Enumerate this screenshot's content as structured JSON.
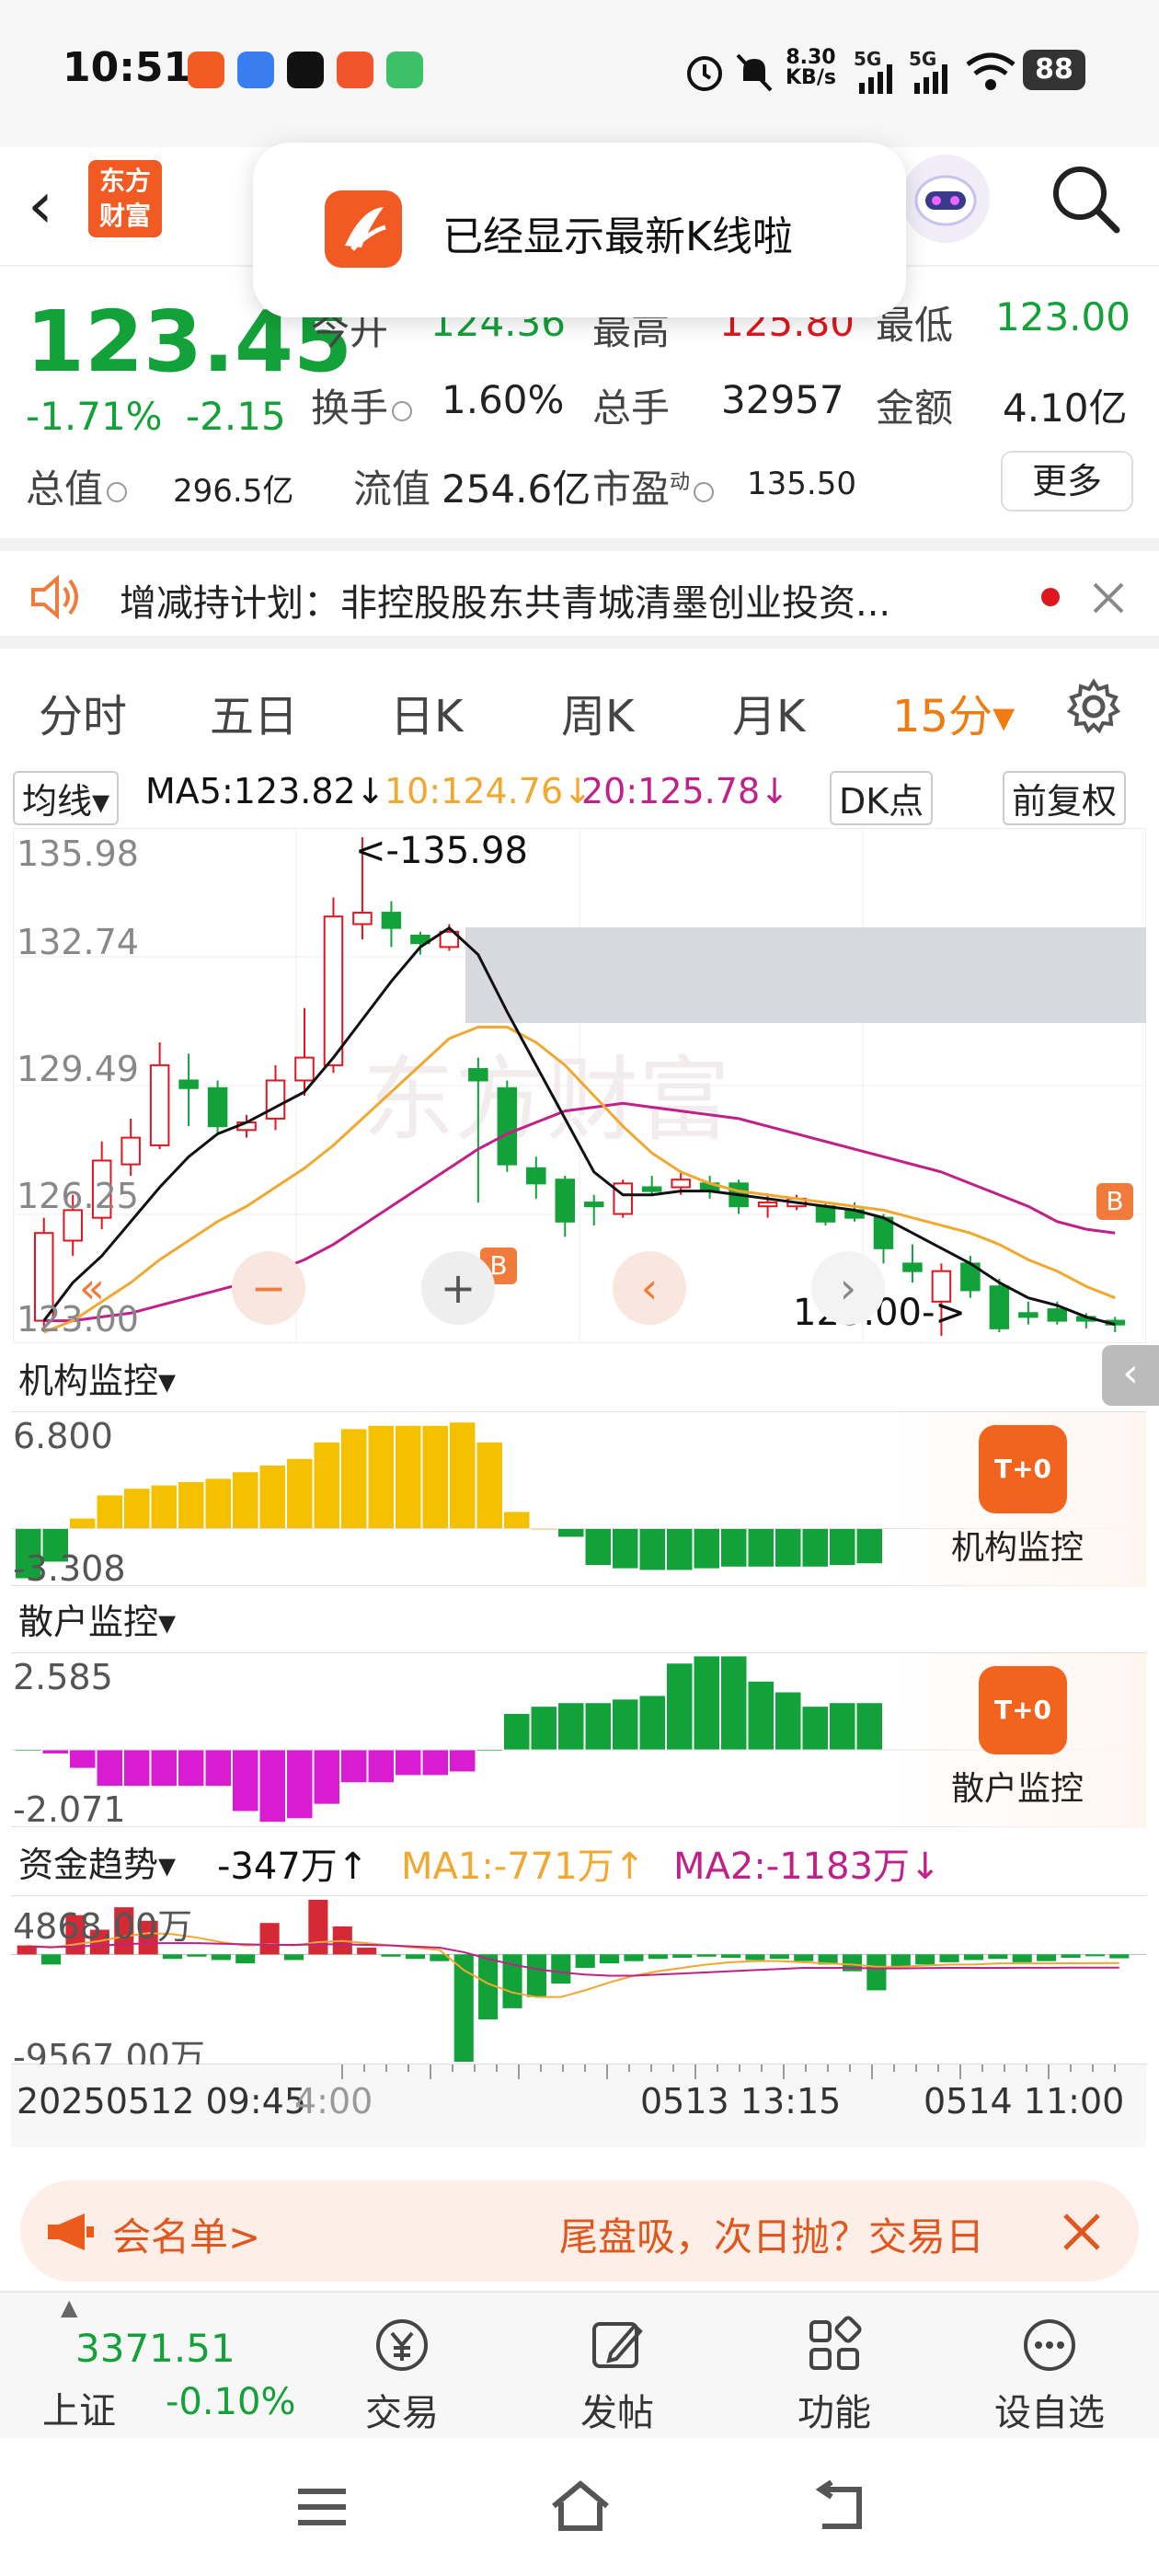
{
  "status": {
    "time": "10:51",
    "net_speed_value": "8.30",
    "net_speed_unit": "KB/s",
    "battery": "88",
    "sig1": "5G",
    "sig2": "5G"
  },
  "header": {
    "back": "‹",
    "logo_line1": "东方",
    "logo_line2": "财富"
  },
  "toast": {
    "text": "已经显示最新K线啦"
  },
  "quote": {
    "price": "123.45",
    "change_pct": "-1.71%",
    "change_amt": "-2.15",
    "open_label": "今开",
    "open_val": "124.36",
    "high_label": "最高",
    "high_val": "125.80",
    "low_label": "最低",
    "low_val": "123.00",
    "turnover_label": "换手",
    "turnover_val": "1.60%",
    "volume_label": "总手",
    "volume_val": "32957",
    "amount_label": "金额",
    "amount_val": "4.10亿",
    "mktcap_label": "总值",
    "mktcap_val": "296.5亿",
    "float_label": "流值",
    "float_val": "254.6亿",
    "pe_label": "市盈",
    "pe_sup": "动",
    "pe_val": "135.50",
    "more_button": "更多"
  },
  "notice": {
    "text": "增减持计划：非控股股东共青城清墨创业投资..."
  },
  "tabs": [
    {
      "label": "分时"
    },
    {
      "label": "五日"
    },
    {
      "label": "日K"
    },
    {
      "label": "周K"
    },
    {
      "label": "月K"
    },
    {
      "label": "15分▾"
    }
  ],
  "ma_row": {
    "avg_button": "均线▾",
    "ma5": "MA5:123.82↓",
    "ma10": "10:124.76↓",
    "ma20": "20:125.78↓",
    "dk_button": "DK点",
    "adj_button": "前复权"
  },
  "colors": {
    "up": "#e0161f",
    "down": "#13a13a",
    "ma5": "#111111",
    "ma10": "#f0a830",
    "ma20": "#c0208a",
    "accent": "#f07b10"
  },
  "chart_data": {
    "type": "candlestick",
    "title": "",
    "y_ticks": [
      "135.98",
      "132.74",
      "129.49",
      "126.25",
      "123.00"
    ],
    "ylim": [
      123.0,
      135.98
    ],
    "max_label": "<-135.98",
    "min_label": "123.00->",
    "candles": [
      {
        "o": 123.3,
        "c": 125.6,
        "h": 126.0,
        "l": 123.0
      },
      {
        "o": 125.4,
        "c": 126.2,
        "h": 126.6,
        "l": 125.0
      },
      {
        "o": 126.0,
        "c": 127.5,
        "h": 128.0,
        "l": 125.7
      },
      {
        "o": 127.4,
        "c": 128.1,
        "h": 128.6,
        "l": 127.1
      },
      {
        "o": 127.9,
        "c": 130.0,
        "h": 130.6,
        "l": 127.8
      },
      {
        "o": 129.6,
        "c": 129.4,
        "h": 130.3,
        "l": 128.4
      },
      {
        "o": 129.4,
        "c": 128.4,
        "h": 129.6,
        "l": 128.2
      },
      {
        "o": 128.3,
        "c": 128.5,
        "h": 128.7,
        "l": 128.1
      },
      {
        "o": 128.6,
        "c": 129.6,
        "h": 130.0,
        "l": 128.3
      },
      {
        "o": 129.6,
        "c": 130.2,
        "h": 131.5,
        "l": 129.2
      },
      {
        "o": 130.0,
        "c": 133.9,
        "h": 134.4,
        "l": 129.8
      },
      {
        "o": 133.7,
        "c": 134.0,
        "h": 135.98,
        "l": 133.3
      },
      {
        "o": 134.0,
        "c": 133.6,
        "h": 134.3,
        "l": 133.1
      },
      {
        "o": 133.4,
        "c": 133.2,
        "h": 133.5,
        "l": 132.9
      },
      {
        "o": 133.1,
        "c": 133.5,
        "h": 133.7,
        "l": 133.0
      },
      {
        "o": 129.9,
        "c": 129.6,
        "h": 130.2,
        "l": 126.4
      },
      {
        "o": 129.4,
        "c": 127.4,
        "h": 129.6,
        "l": 127.2
      },
      {
        "o": 127.3,
        "c": 126.9,
        "h": 127.6,
        "l": 126.5
      },
      {
        "o": 127.0,
        "c": 125.9,
        "h": 127.1,
        "l": 125.5
      },
      {
        "o": 126.4,
        "c": 126.3,
        "h": 126.6,
        "l": 125.8
      },
      {
        "o": 126.1,
        "c": 126.9,
        "h": 127.0,
        "l": 126.0
      },
      {
        "o": 126.8,
        "c": 126.7,
        "h": 127.1,
        "l": 126.6
      },
      {
        "o": 126.8,
        "c": 127.0,
        "h": 127.2,
        "l": 126.6
      },
      {
        "o": 126.9,
        "c": 126.7,
        "h": 127.1,
        "l": 126.5
      },
      {
        "o": 126.9,
        "c": 126.3,
        "h": 127.0,
        "l": 126.1
      },
      {
        "o": 126.3,
        "c": 126.4,
        "h": 126.6,
        "l": 126.0
      },
      {
        "o": 126.3,
        "c": 126.5,
        "h": 126.6,
        "l": 126.2
      },
      {
        "o": 126.3,
        "c": 125.9,
        "h": 126.4,
        "l": 125.8
      },
      {
        "o": 126.2,
        "c": 126.0,
        "h": 126.4,
        "l": 125.9
      },
      {
        "o": 126.0,
        "c": 125.2,
        "h": 126.1,
        "l": 124.8
      },
      {
        "o": 124.8,
        "c": 124.6,
        "h": 125.3,
        "l": 124.3
      },
      {
        "o": 123.8,
        "c": 124.6,
        "h": 124.8,
        "l": 122.9
      },
      {
        "o": 124.8,
        "c": 124.1,
        "h": 125.0,
        "l": 123.9
      },
      {
        "o": 124.2,
        "c": 123.1,
        "h": 124.4,
        "l": 123.0
      },
      {
        "o": 123.5,
        "c": 123.4,
        "h": 123.8,
        "l": 123.2
      },
      {
        "o": 123.6,
        "c": 123.3,
        "h": 123.8,
        "l": 123.2
      },
      {
        "o": 123.4,
        "c": 123.3,
        "h": 123.5,
        "l": 123.1
      },
      {
        "o": 123.3,
        "c": 123.2,
        "h": 123.4,
        "l": 123.0
      }
    ],
    "ma5": [
      123.3,
      124.3,
      125.0,
      125.9,
      126.8,
      127.6,
      128.2,
      128.5,
      128.9,
      129.3,
      130.2,
      131.2,
      132.2,
      133.1,
      133.6,
      132.9,
      131.4,
      130.0,
      128.6,
      127.2,
      126.6,
      126.6,
      126.7,
      126.7,
      126.6,
      126.5,
      126.4,
      126.3,
      126.2,
      126.0,
      125.6,
      125.2,
      124.8,
      124.3,
      123.9,
      123.7,
      123.4,
      123.2
    ],
    "ma10": [
      123.0,
      123.3,
      123.8,
      124.3,
      124.9,
      125.4,
      125.9,
      126.3,
      126.8,
      127.3,
      127.9,
      128.6,
      129.3,
      130.0,
      130.7,
      131.0,
      131.0,
      130.6,
      130.0,
      129.2,
      128.4,
      127.7,
      127.2,
      126.9,
      126.7,
      126.6,
      126.5,
      126.4,
      126.3,
      126.2,
      126.0,
      125.8,
      125.6,
      125.3,
      124.9,
      124.6,
      124.2,
      123.9
    ],
    "ma20": [
      123.3,
      123.3,
      123.4,
      123.5,
      123.7,
      123.9,
      124.1,
      124.3,
      124.6,
      124.9,
      125.3,
      125.8,
      126.3,
      126.8,
      127.3,
      127.8,
      128.2,
      128.5,
      128.8,
      128.9,
      129.0,
      128.9,
      128.8,
      128.7,
      128.6,
      128.4,
      128.2,
      128.0,
      127.8,
      127.6,
      127.4,
      127.2,
      126.9,
      126.6,
      126.3,
      125.9,
      125.7,
      125.6
    ],
    "sub_charts": [
      {
        "name": "机构监控",
        "ymax_label": "6.800",
        "ymin_label": "-3.308",
        "ylim": [
          -3.308,
          6.8
        ],
        "values": [
          -3.0,
          -2.0,
          0.6,
          2.0,
          2.4,
          2.6,
          2.8,
          3.0,
          3.4,
          3.8,
          4.2,
          5.2,
          6.0,
          6.2,
          6.2,
          6.2,
          6.4,
          5.2,
          1.0,
          0.0,
          -0.5,
          -2.2,
          -2.4,
          -2.5,
          -2.5,
          -2.4,
          -2.3,
          -2.3,
          -2.3,
          -2.3,
          -2.2,
          -2.1
        ]
      },
      {
        "name": "散户监控",
        "ymax_label": "2.585",
        "ymin_label": "-2.071",
        "ylim": [
          -2.071,
          2.585
        ],
        "values": [
          0.0,
          -0.1,
          -0.5,
          -1.0,
          -1.0,
          -1.0,
          -1.0,
          -1.0,
          -1.7,
          -2.0,
          -1.9,
          -1.5,
          -0.9,
          -0.9,
          -0.7,
          -0.7,
          -0.6,
          0.0,
          1.0,
          1.2,
          1.3,
          1.3,
          1.4,
          1.5,
          2.4,
          2.6,
          2.6,
          1.9,
          1.6,
          1.2,
          1.3,
          1.3
        ]
      },
      {
        "name": "资金趋势",
        "ymax_label": "4868.00万",
        "ymin_label": "-9567.00万",
        "ylim": [
          -9567.0,
          4868.0
        ],
        "value_label": "-347万↑",
        "ma1_label": "MA1:-771万↑",
        "ma2_label": "MA2:-1183万↓",
        "values": [
          800,
          -900,
          3500,
          2200,
          4200,
          3000,
          -400,
          -200,
          -500,
          -800,
          2800,
          -500,
          4868,
          2500,
          600,
          -200,
          -400,
          -600,
          -9567,
          -5800,
          -4800,
          -3800,
          -2600,
          -1200,
          -800,
          -600,
          -400,
          -300,
          -200,
          -300,
          -500,
          -400,
          -600,
          -900,
          -1500,
          -3200,
          -1100,
          -900,
          -700,
          -500,
          -400,
          -700,
          -600,
          -300,
          -100,
          -347
        ],
        "ma1": [
          800,
          600,
          900,
          1200,
          1600,
          1900,
          1800,
          1500,
          1100,
          800,
          900,
          800,
          1100,
          1200,
          1000,
          800,
          600,
          400,
          -1400,
          -2600,
          -3400,
          -3800,
          -3800,
          -3200,
          -2500,
          -1900,
          -1500,
          -1200,
          -900,
          -700,
          -600,
          -600,
          -700,
          -800,
          -900,
          -1100,
          -1100,
          -1000,
          -900,
          -900,
          -800,
          -800,
          -800,
          -790,
          -780,
          -771
        ],
        "ma2": [
          700,
          650,
          700,
          800,
          900,
          1000,
          1000,
          1000,
          950,
          900,
          850,
          850,
          900,
          900,
          850,
          800,
          700,
          600,
          200,
          -400,
          -900,
          -1300,
          -1600,
          -1800,
          -1900,
          -1900,
          -1800,
          -1700,
          -1600,
          -1500,
          -1400,
          -1300,
          -1200,
          -1200,
          -1200,
          -1250,
          -1250,
          -1220,
          -1200,
          -1200,
          -1200,
          -1190,
          -1190,
          -1185,
          -1184,
          -1183
        ]
      }
    ],
    "x_labels": [
      "20250512 09:45",
      "0513 13:15",
      "0514 11:00"
    ],
    "x_overlap_label": "4:00"
  },
  "sub_labels": {
    "inst": "机构监控▾",
    "retail": "散户监控▾",
    "fund": "资金趋势▾"
  },
  "monitor_cards": {
    "inst": "机构监控",
    "retail": "散户监控",
    "icon_text": "T+0"
  },
  "ad": {
    "left": "会名单>",
    "right": "尾盘吸，次日抛？交易日"
  },
  "bottom_nav": {
    "index_value": "3371.51",
    "index_name": "上证",
    "index_change": "-0.10%",
    "items": [
      {
        "label": "交易"
      },
      {
        "label": "发帖"
      },
      {
        "label": "功能"
      },
      {
        "label": "设自选"
      }
    ]
  }
}
